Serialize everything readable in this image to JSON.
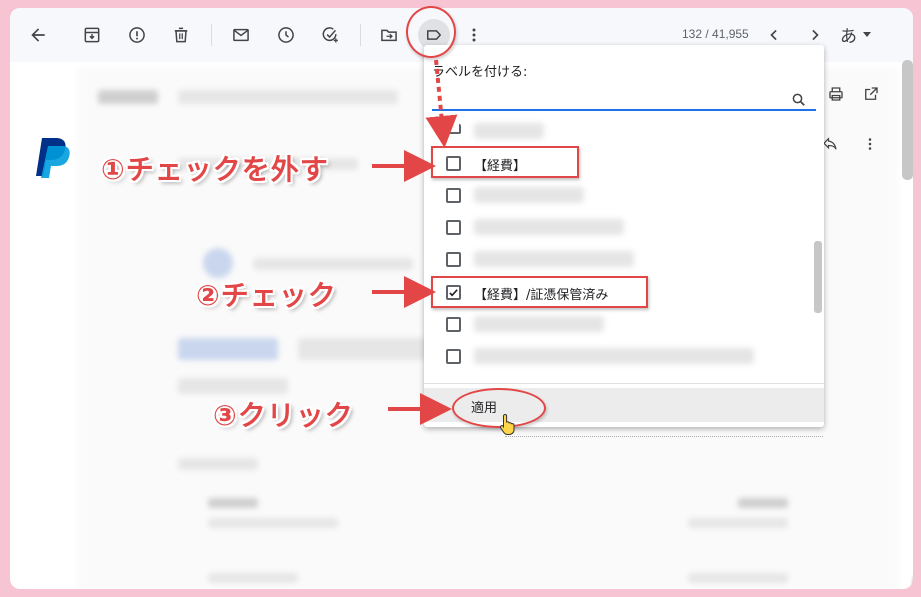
{
  "toolbar": {
    "pager": "132 / 41,955",
    "ime_label": "あ"
  },
  "dropdown": {
    "title": "ラベルを付ける:",
    "search_placeholder": "",
    "rows": [
      {
        "label": "",
        "checked": false,
        "blurred": true
      },
      {
        "label": "【経費】",
        "checked": false,
        "blurred": false
      },
      {
        "label": "",
        "checked": false,
        "blurred": true
      },
      {
        "label": "",
        "checked": false,
        "blurred": true
      },
      {
        "label": "",
        "checked": false,
        "blurred": true
      },
      {
        "label": "【経費】/証憑保管済み",
        "checked": true,
        "blurred": false
      },
      {
        "label": "",
        "checked": false,
        "blurred": true
      },
      {
        "label": "",
        "checked": false,
        "blurred": true
      }
    ],
    "apply_label": "適用"
  },
  "annotations": {
    "step1": "①チェックを外す",
    "step2": "②チェック",
    "step3": "③クリック"
  },
  "colors": {
    "annotation_red": "#e24646",
    "background_pink": "#f6c4d2",
    "focus_blue": "#1a73e8"
  },
  "icons": [
    "back-arrow-icon",
    "archive-icon",
    "report-spam-icon",
    "delete-icon",
    "mark-unread-icon",
    "snooze-icon",
    "add-task-icon",
    "move-to-icon",
    "label-icon",
    "more-vert-icon",
    "chevron-left-icon",
    "chevron-right-icon",
    "search-icon",
    "print-icon",
    "open-in-new-icon",
    "reply-icon",
    "pointer-hand-icon"
  ]
}
